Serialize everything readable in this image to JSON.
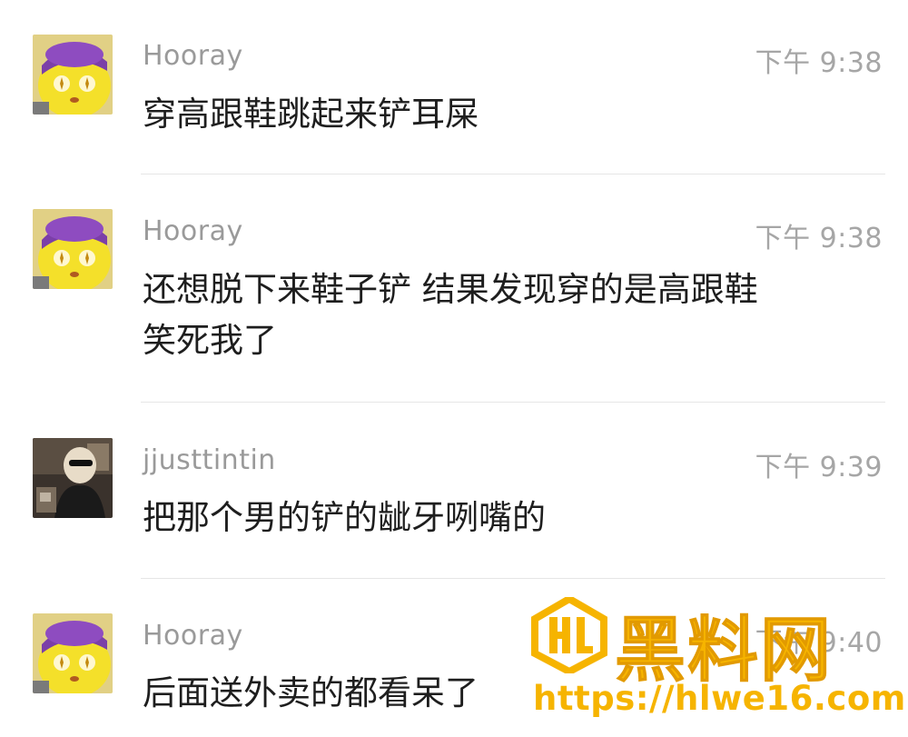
{
  "messages": [
    {
      "username": "Hooray",
      "time": "下午 9:38",
      "text": "穿高跟鞋跳起来铲耳屎",
      "avatar": "yellow-cartoon-avatar"
    },
    {
      "username": "Hooray",
      "time": "下午 9:38",
      "text": "还想脱下来鞋子铲 结果发现穿的是高跟鞋\n笑死我了",
      "avatar": "yellow-cartoon-avatar"
    },
    {
      "username": "jjusttintin",
      "time": "下午 9:39",
      "text": "把那个男的铲的龇牙咧嘴的",
      "avatar": "photo-avatar"
    },
    {
      "username": "Hooray",
      "time": "下午 9:40",
      "text": "后面送外卖的都看呆了",
      "avatar": "yellow-cartoon-avatar"
    }
  ],
  "watermark": {
    "logo_text": "HL",
    "title": "黑料网",
    "url": "https://hlwe16.com",
    "color": "#f6b400"
  },
  "colors": {
    "username": "#9a9a9a",
    "time": "#a6a6a6",
    "message_text": "#1e1e1e",
    "divider": "#e6e6e6",
    "background": "#ffffff"
  }
}
